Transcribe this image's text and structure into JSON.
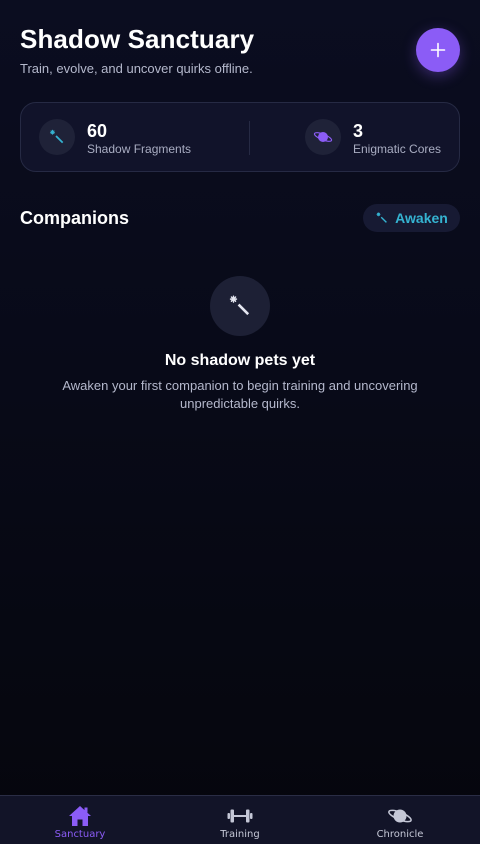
{
  "header": {
    "title": "Shadow Sanctuary",
    "subtitle": "Train, evolve, and uncover quirks offline.",
    "add_button_icon": "plus-icon"
  },
  "stats": [
    {
      "value": "60",
      "label": "Shadow Fragments",
      "icon": "magic-wand-icon"
    },
    {
      "value": "3",
      "label": "Enigmatic Cores",
      "icon": "planet-icon"
    }
  ],
  "companions": {
    "title": "Companions",
    "awaken_label": "Awaken",
    "awaken_icon": "magic-wand-icon"
  },
  "empty_state": {
    "icon": "magic-wand-icon",
    "title": "No shadow pets yet",
    "description": "Awaken your first companion to begin training and uncovering unpredictable quirks."
  },
  "nav": {
    "items": [
      {
        "label": "Sanctuary",
        "icon": "home-icon",
        "active": true
      },
      {
        "label": "Training",
        "icon": "dumbbell-icon",
        "active": false
      },
      {
        "label": "Chronicle",
        "icon": "planet-icon",
        "active": false
      }
    ]
  },
  "colors": {
    "accent": "#8b5cf6",
    "awaken_text": "#35b3d1",
    "background": "#0b0d20",
    "card": "#11132a",
    "muted_text": "#b4b8cc"
  }
}
